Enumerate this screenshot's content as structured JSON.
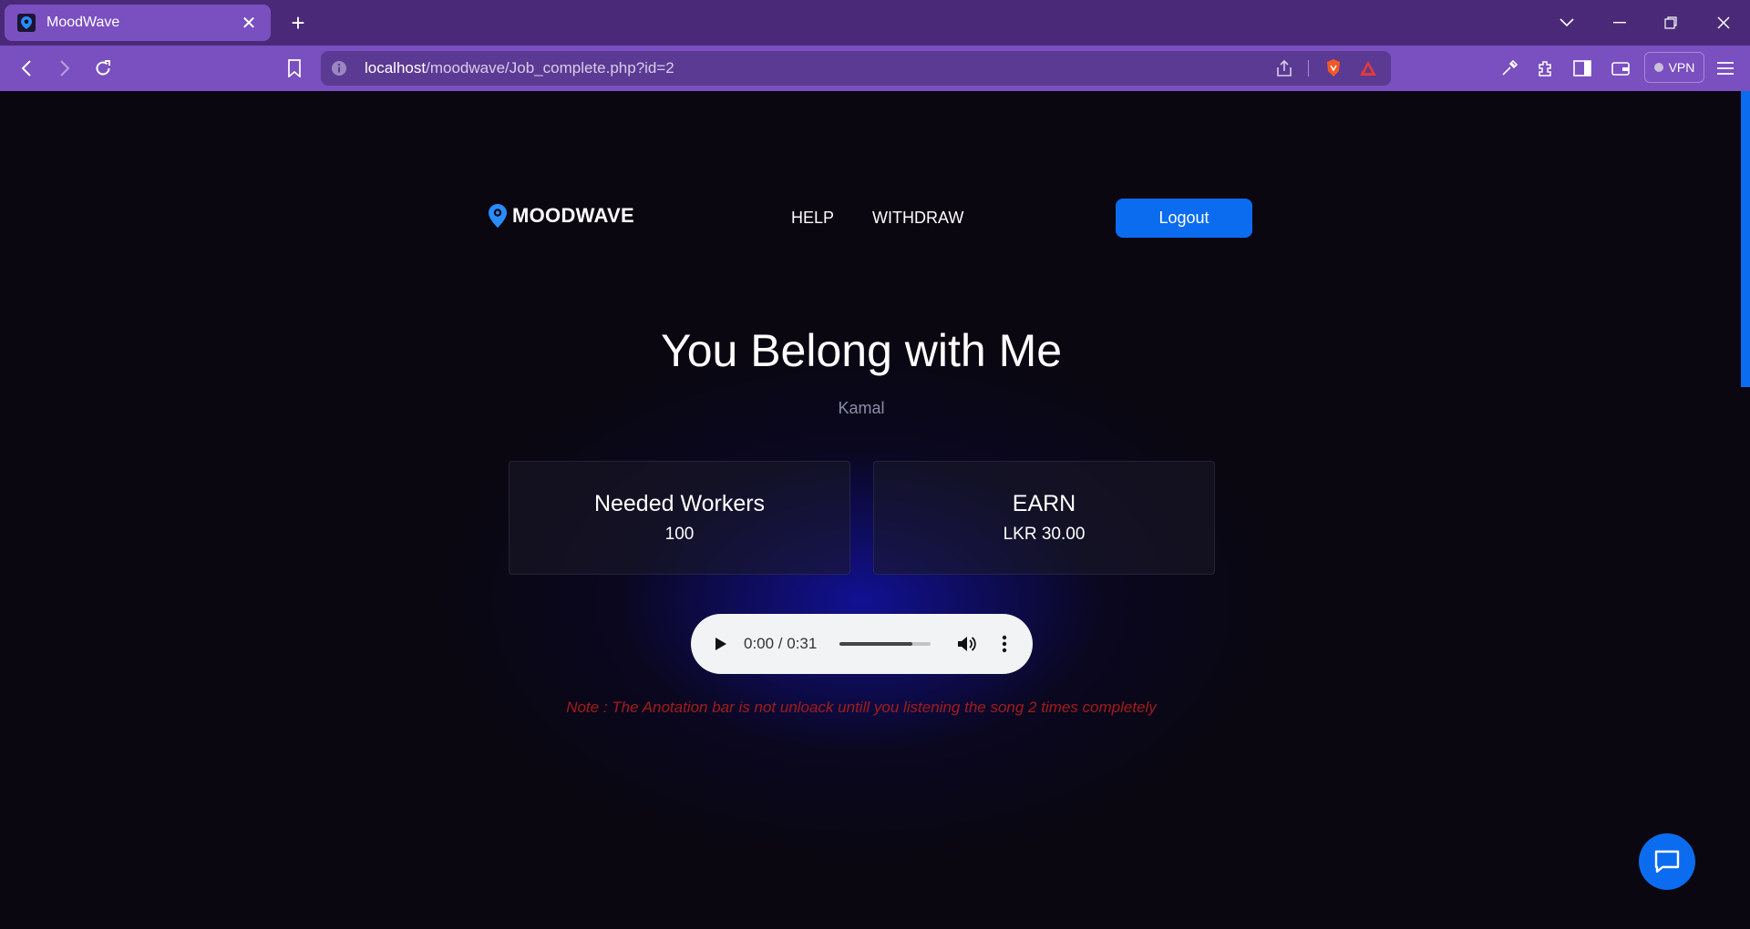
{
  "browser": {
    "tab_title": "MoodWave",
    "tab_close": "✕",
    "new_tab": "+",
    "url_host": "localhost",
    "url_path": "/moodwave/Job_complete.php?id=2",
    "vpn_label": "VPN"
  },
  "header": {
    "brand": "MOODWAVE",
    "nav": [
      "HELP",
      "WITHDRAW"
    ],
    "logout_label": "Logout"
  },
  "song": {
    "title": "You Belong with Me",
    "artist": "Kamal"
  },
  "stats": [
    {
      "label": "Needed Workers",
      "value": "100"
    },
    {
      "label": "EARN",
      "value": "LKR 30.00"
    }
  ],
  "player": {
    "time": "0:00 / 0:31",
    "volume_fraction": 0.8
  },
  "note": "Note : The Anotation bar is not unloack untill you listening the song 2 times completely",
  "colors": {
    "accent": "#0b6cf0",
    "chrome": "#7a4fc0",
    "note": "#a31b1b"
  }
}
